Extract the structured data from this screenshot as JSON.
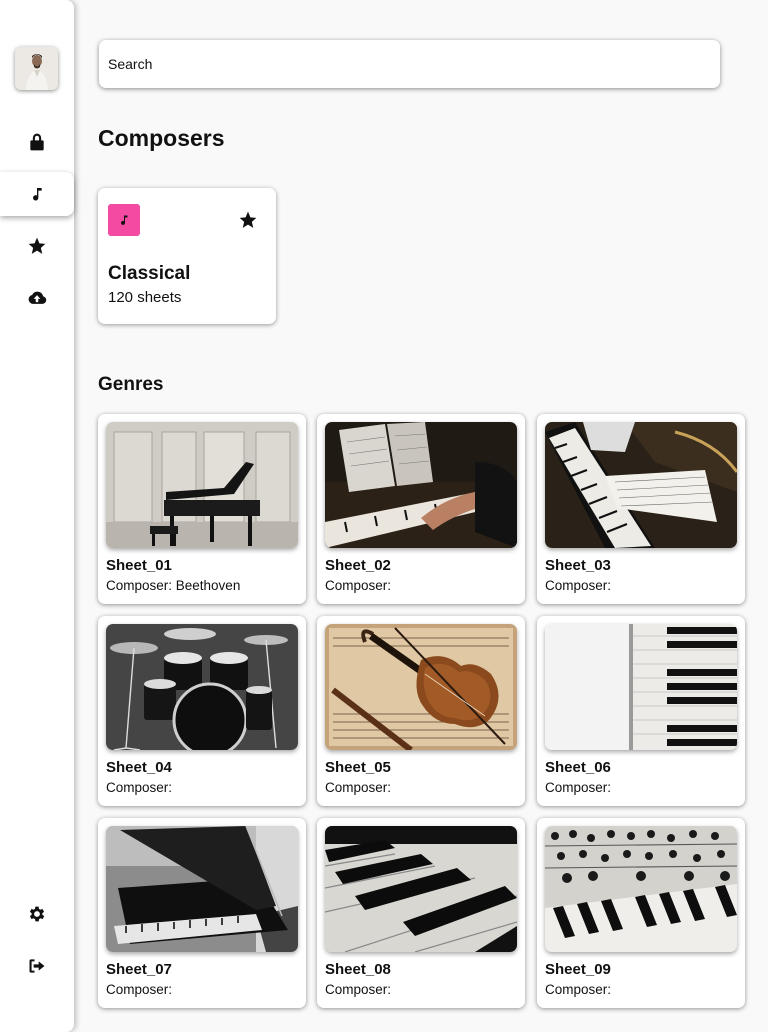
{
  "search": {
    "placeholder": "Search"
  },
  "sidebar": {
    "avatar_icon": "user-avatar",
    "items": [
      {
        "id": "lock",
        "icon": "lock-icon"
      },
      {
        "id": "music",
        "icon": "music-note-icon",
        "active": true
      },
      {
        "id": "favorites",
        "icon": "star-icon"
      },
      {
        "id": "upload",
        "icon": "cloud-upload-icon"
      },
      {
        "id": "settings",
        "icon": "gear-icon"
      },
      {
        "id": "logout",
        "icon": "logout-icon"
      }
    ]
  },
  "composers": {
    "heading": "Composers",
    "card": {
      "title": "Classical",
      "count": "120 sheets",
      "badge_color": "#f54aa2",
      "badge_icon": "music-note-icon",
      "fav_icon": "star-icon"
    }
  },
  "genres": {
    "heading": "Genres",
    "sheets": [
      {
        "name": "Sheet_01",
        "composer": "Composer: Beethoven"
      },
      {
        "name": "Sheet_02",
        "composer": "Composer:"
      },
      {
        "name": "Sheet_03",
        "composer": "Composer:"
      },
      {
        "name": "Sheet_04",
        "composer": "Composer:"
      },
      {
        "name": "Sheet_05",
        "composer": "Composer:"
      },
      {
        "name": "Sheet_06",
        "composer": "Composer:"
      },
      {
        "name": "Sheet_07",
        "composer": "Composer:"
      },
      {
        "name": "Sheet_08",
        "composer": "Composer:"
      },
      {
        "name": "Sheet_09",
        "composer": "Composer:"
      }
    ]
  }
}
